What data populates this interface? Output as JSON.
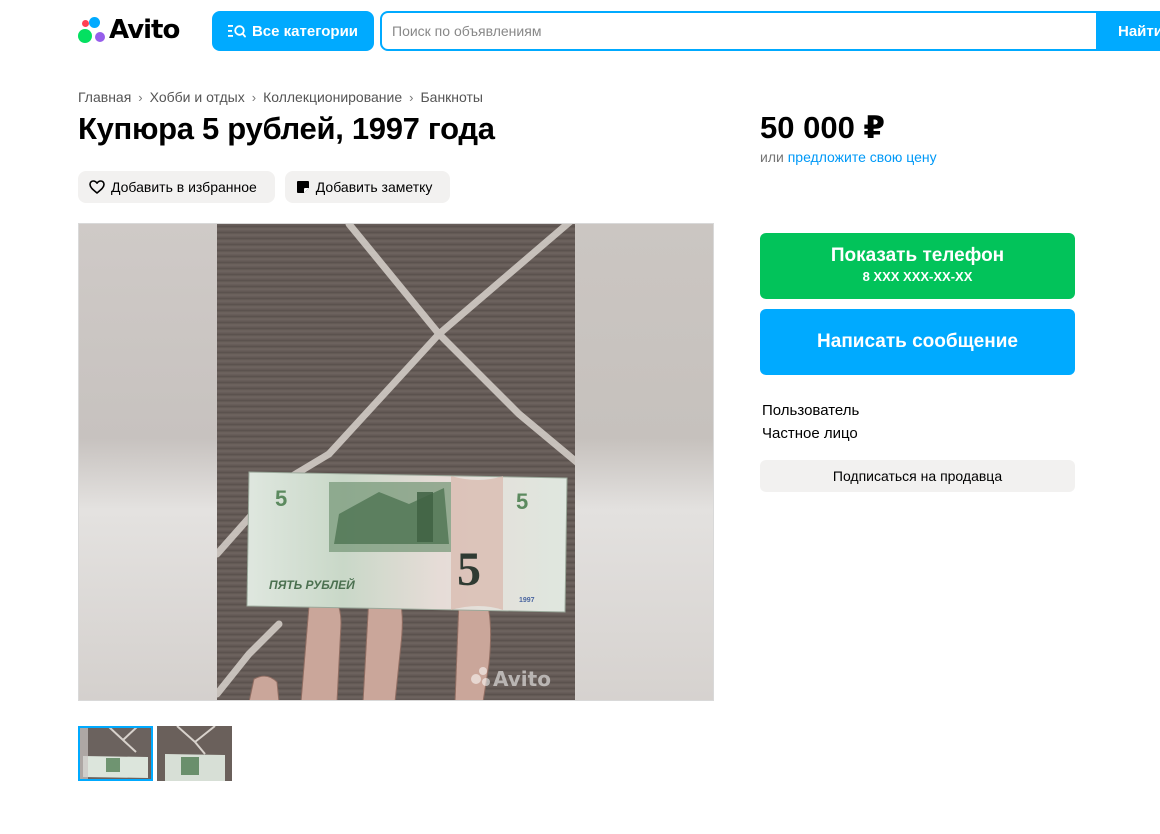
{
  "header": {
    "logo_text": "Avito",
    "categories_label": "Все категории",
    "search_placeholder": "Поиск по объявлениям",
    "find_label": "Найти"
  },
  "breadcrumbs": [
    "Главная",
    "Хобби и отдых",
    "Коллекционирование",
    "Банкноты"
  ],
  "listing": {
    "title": "Купюра 5 рублей, 1997 года",
    "add_favorite_label": "Добавить в избранное",
    "add_note_label": "Добавить заметку",
    "photos": [
      {
        "kind": "banknote photo",
        "watermark": "Avito"
      },
      {
        "kind": "banknote photo"
      }
    ]
  },
  "sidebar": {
    "price": "50 000 ₽",
    "offer_prefix": "или",
    "offer_link": "предложите свою цену",
    "show_phone_label": "Показать телефон",
    "phone_masked": "8 XXX XXX-XX-XX",
    "write_message_label": "Написать сообщение",
    "seller_name": "Пользователь",
    "seller_type": "Частное лицо",
    "subscribe_label": "Подписаться на продавца"
  },
  "banknote": {
    "denomination": "5",
    "text": "ПЯТЬ РУБЛЕЙ",
    "year": "1997"
  },
  "colors": {
    "accent_blue": "#00aaff",
    "phone_green": "#02c35a",
    "link_blue": "#0099f7",
    "button_grey": "#f2f1f0"
  },
  "icons": {
    "categories": "menu-search-icon",
    "favorite": "heart-icon",
    "note": "note-icon"
  }
}
